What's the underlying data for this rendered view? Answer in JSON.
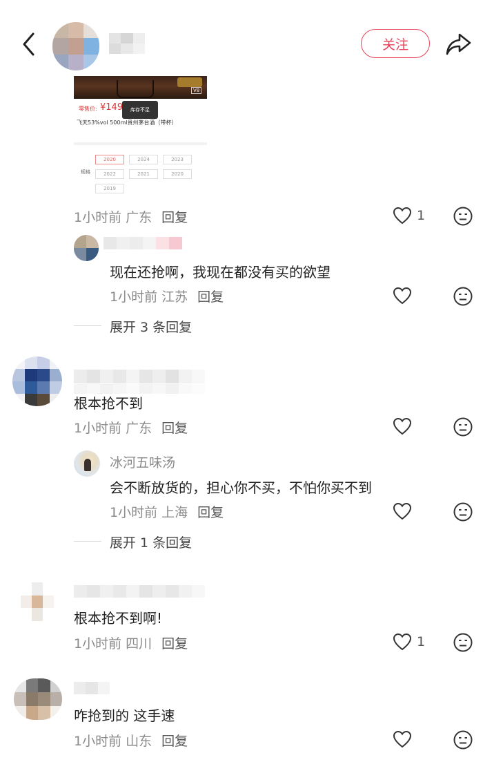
{
  "header": {
    "back_icon": "chevron-left-icon",
    "follow_label": "关注",
    "share_icon": "share-icon"
  },
  "product": {
    "price_label": "零售价:",
    "price": "¥149",
    "stock_toast": "库存不足",
    "title": "飞天53%vol 500ml贵州茅台酒（带杯）",
    "image_badge": "V8",
    "spec_label": "规格",
    "specs": [
      "2020",
      "2024",
      "2023",
      "2022",
      "2021",
      "2020",
      "2019"
    ]
  },
  "comments": [
    {
      "meta": "1小时前 广东",
      "reply": "回复",
      "likes": "1"
    },
    {
      "text": "现在还抢啊，我现在都没有买的欲望",
      "meta": "1小时前 江苏",
      "reply": "回复",
      "expand": "展开 3 条回复"
    },
    {
      "text": "根本抢不到",
      "meta": "1小时前 广东",
      "reply": "回复"
    },
    {
      "name": "冰河五味汤",
      "text": "会不断放货的，担心你不买，不怕你买不到",
      "meta": "1小时前 上海",
      "reply": "回复",
      "expand": "展开 1 条回复"
    },
    {
      "text": "根本抢不到啊!",
      "meta": "1小时前 四川",
      "reply": "回复",
      "likes": "1"
    },
    {
      "text": "咋抢到的 这手速",
      "meta": "1小时前 山东",
      "reply": "回复"
    }
  ],
  "colors": {
    "accent": "#e8425a"
  }
}
